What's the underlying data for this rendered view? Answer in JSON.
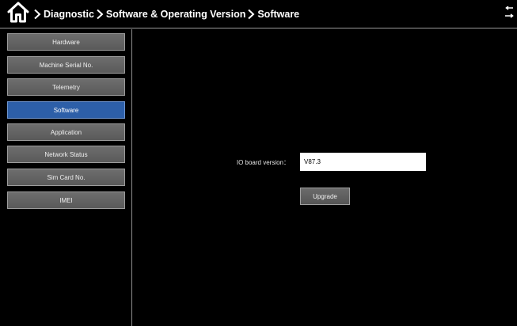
{
  "header": {
    "breadcrumbs": [
      {
        "label": "Diagnostic"
      },
      {
        "label": "Software & Operating Version"
      },
      {
        "label": "Software"
      }
    ],
    "icons": {
      "home": "home-icon",
      "back": "back-arrow-icon",
      "separator": "chevron-right-icon"
    }
  },
  "sidebar": {
    "items": [
      {
        "label": "Hardware",
        "active": false
      },
      {
        "label": "Machine Serial No.",
        "active": false
      },
      {
        "label": "Telemetry",
        "active": false
      },
      {
        "label": "Software",
        "active": true
      },
      {
        "label": "Application",
        "active": false
      },
      {
        "label": "Network Status",
        "active": false
      },
      {
        "label": "Sim Card No.",
        "active": false
      },
      {
        "label": "IMEI",
        "active": false
      }
    ]
  },
  "main": {
    "io_board_label": "IO board version：",
    "io_board_value": "V87.3",
    "upgrade_label": "Upgrade"
  },
  "colors": {
    "background": "#000000",
    "active_item": "#2d5fa8",
    "inactive_item": "#636363",
    "field_bg": "#ffffff"
  }
}
